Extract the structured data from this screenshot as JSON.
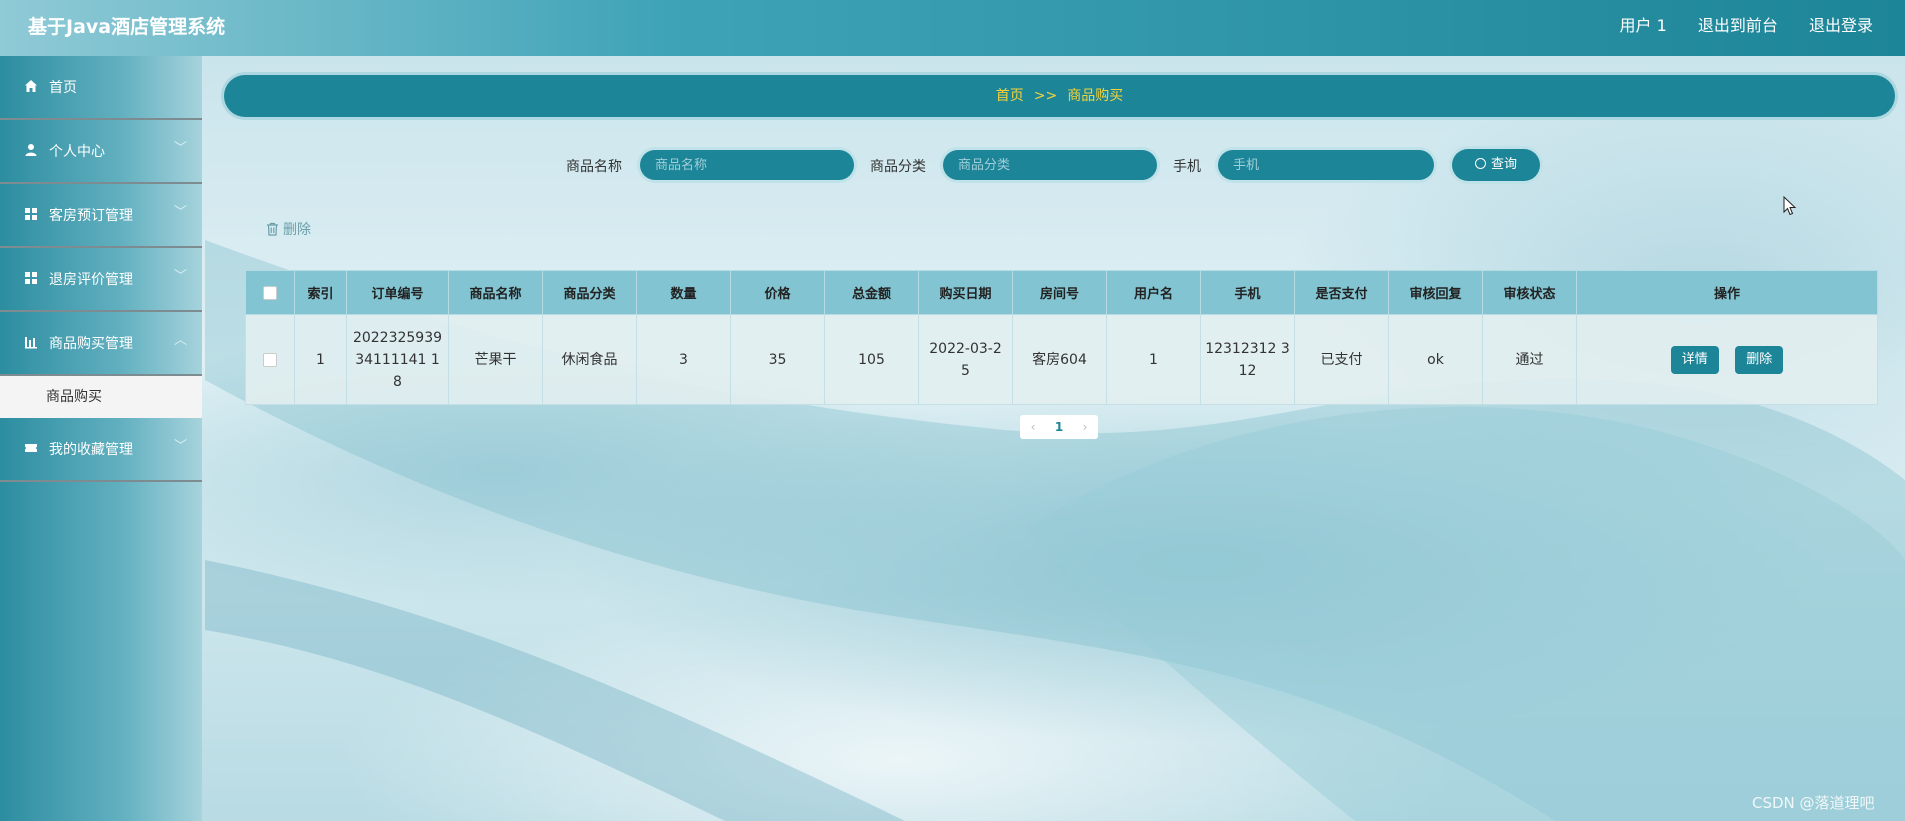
{
  "app": {
    "title": "基于Java酒店管理系统"
  },
  "header": {
    "user": "用户 1",
    "front": "退出到前台",
    "logout": "退出登录"
  },
  "sidebar": {
    "items": [
      {
        "label": "首页",
        "icon": "home-icon",
        "expandable": false
      },
      {
        "label": "个人中心",
        "icon": "person-icon",
        "expandable": true
      },
      {
        "label": "客房预订管理",
        "icon": "grid-icon",
        "expandable": true
      },
      {
        "label": "退房评价管理",
        "icon": "grid-icon",
        "expandable": true
      },
      {
        "label": "商品购买管理",
        "icon": "chart-icon",
        "expandable": true
      },
      {
        "label": "我的收藏管理",
        "icon": "ticket-icon",
        "expandable": true
      }
    ],
    "active_sub": "商品购买"
  },
  "breadcrumb": {
    "home": "首页",
    "sep": ">>",
    "current": "商品购买"
  },
  "search": {
    "name_label": "商品名称",
    "name_placeholder": "商品名称",
    "category_label": "商品分类",
    "category_placeholder": "商品分类",
    "phone_label": "手机",
    "phone_placeholder": "手机",
    "query": "查询"
  },
  "actions": {
    "delete": "删除"
  },
  "table": {
    "headers": [
      "索引",
      "订单编号",
      "商品名称",
      "商品分类",
      "数量",
      "价格",
      "总金额",
      "购买日期",
      "房间号",
      "用户名",
      "手机",
      "是否支付",
      "审核回复",
      "审核状态",
      "操作"
    ],
    "rows": [
      {
        "index": "1",
        "order_no": "202232593934111141 18",
        "name": "芒果干",
        "category": "休闲食品",
        "qty": "3",
        "price": "35",
        "total": "105",
        "date": "2022-03-2 5",
        "room": "客房604",
        "user": "1",
        "phone": "12312312 312",
        "paid": "已支付",
        "reply": "ok",
        "status": "通过",
        "detail_btn": "详情",
        "delete_btn": "删除"
      }
    ]
  },
  "pager": {
    "current": "1"
  },
  "watermark": "CSDN @落道理吧",
  "colors": {
    "primary": "#1d8598",
    "breadcrumb_text": "#f3d33a",
    "table_header": "#82c4d1"
  }
}
